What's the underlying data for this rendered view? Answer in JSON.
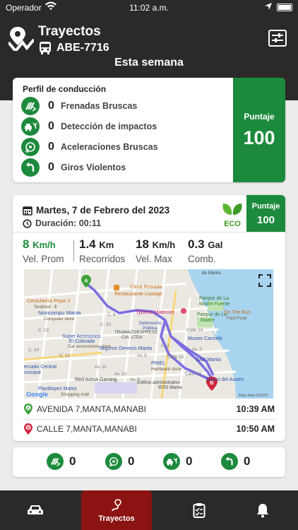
{
  "status_bar": {
    "carrier": "Operador",
    "time": "11:02 a.m."
  },
  "header": {
    "title": "Trayectos",
    "plate": "ABE-7716",
    "period": "Esta semana"
  },
  "profile": {
    "title": "Perfil de conducción",
    "items": [
      {
        "icon": "hard-brake-icon",
        "count": "0",
        "label": "Frenadas Bruscas"
      },
      {
        "icon": "impact-icon",
        "count": "0",
        "label": "Detección de impactos"
      },
      {
        "icon": "acceleration-icon",
        "count": "0",
        "label": "Aceleraciones Bruscas"
      },
      {
        "icon": "turn-icon",
        "count": "0",
        "label": "Giros Violentos"
      }
    ],
    "score_label": "Puntaje",
    "score_value": "100"
  },
  "trip": {
    "date": "Martes, 7 de Febrero del 2023",
    "duration": "Duración: 00:11",
    "eco_label": "ECO",
    "score_label": "Puntaje",
    "score_value": "100",
    "stats": [
      {
        "value": "8",
        "unit": "Km/h",
        "label": "Vel. Prom"
      },
      {
        "value": "1.4",
        "unit": "Km",
        "label": "Recorridos"
      },
      {
        "value": "18",
        "unit": "Km/h",
        "label": "Vel. Max"
      },
      {
        "value": "0.3",
        "unit": "Gal",
        "label": "Comb."
      }
    ],
    "map": {
      "labels": {
        "casa_rosada": "Casa Rosada",
        "restaurante": "Restaurante Lounge",
        "ceviche": "Cevichería Pepe 2",
        "seafood": "Seafood · $",
        "novicompu": "Novicompu Manta",
        "computer": "Computer store",
        "tybeca": "Tybeca Malecón",
        "parque1": "Parque de La",
        "parque1b": "Madre Fuente",
        "parque2": "Parque de La",
        "parque2b": "Madre",
        "onthe": "On The Run",
        "fastfood": "Fast Food",
        "defensoria": "Defensoría",
        "publica": "Pública",
        "tramaco": "TRAMACOEXPRESS",
        "cialtda": "CIA. LTDA",
        "super1": "Super Accesorios",
        "super2": "El Colorado",
        "super3": "Car accessories store",
        "museo": "Museo Cancebi",
        "seguros": "Seguros Genesis Manta",
        "priel": "PRIEL",
        "hardware": "Hardware store",
        "sad": "SAD Manta",
        "mercado": "ercado Central",
        "unicipal": "unicipal",
        "redarena": "Red Arena Gaming",
        "edificio": "Edificio administrativo",
        "iess": "IESS Manta",
        "banco": "Banco del Austro",
        "plasti": "Plastilopez Matriz",
        "shopping": "Shopping mall",
        "google": "Google",
        "mapdata": "Map data ©2023",
        "de_manta": "de Manta",
        "c13": "C. 13",
        "c12": "C. 12",
        "c14": "C. 14",
        "av11": "Av. 11",
        "av10": "Av. 10",
        "av9": "Av. 9",
        "av8": "Av. 8",
        "calle15": "Calle 15",
        "c2": "C. 2",
        "av2": "Av. 2",
        "calle16": "Calle 16",
        "calle14": "Calle 14",
        "c8": "C. 8",
        "c10": "C. 10",
        "pin_a": "A",
        "pin_b": "B"
      }
    },
    "origin": {
      "address": "AVENIDA 7,MANTA,MANABI",
      "time": "10:39 AM"
    },
    "destination": {
      "address": "CALLE 7,MANTA,MANABI",
      "time": "10:50 AM"
    }
  },
  "summary": [
    {
      "icon": "hard-brake-icon",
      "count": "0"
    },
    {
      "icon": "acceleration-icon",
      "count": "0"
    },
    {
      "icon": "impact-icon",
      "count": "0"
    },
    {
      "icon": "turn-icon",
      "count": "0"
    }
  ],
  "tabs": [
    {
      "name": "vehicle",
      "label": ""
    },
    {
      "name": "trips",
      "label": "Trayectos"
    },
    {
      "name": "reports",
      "label": ""
    },
    {
      "name": "alerts",
      "label": ""
    }
  ],
  "colors": {
    "primary_green": "#1c8a3c",
    "header_dark": "#2b2a29",
    "active_tab": "#8b1412",
    "route": "#7b6ee0"
  }
}
